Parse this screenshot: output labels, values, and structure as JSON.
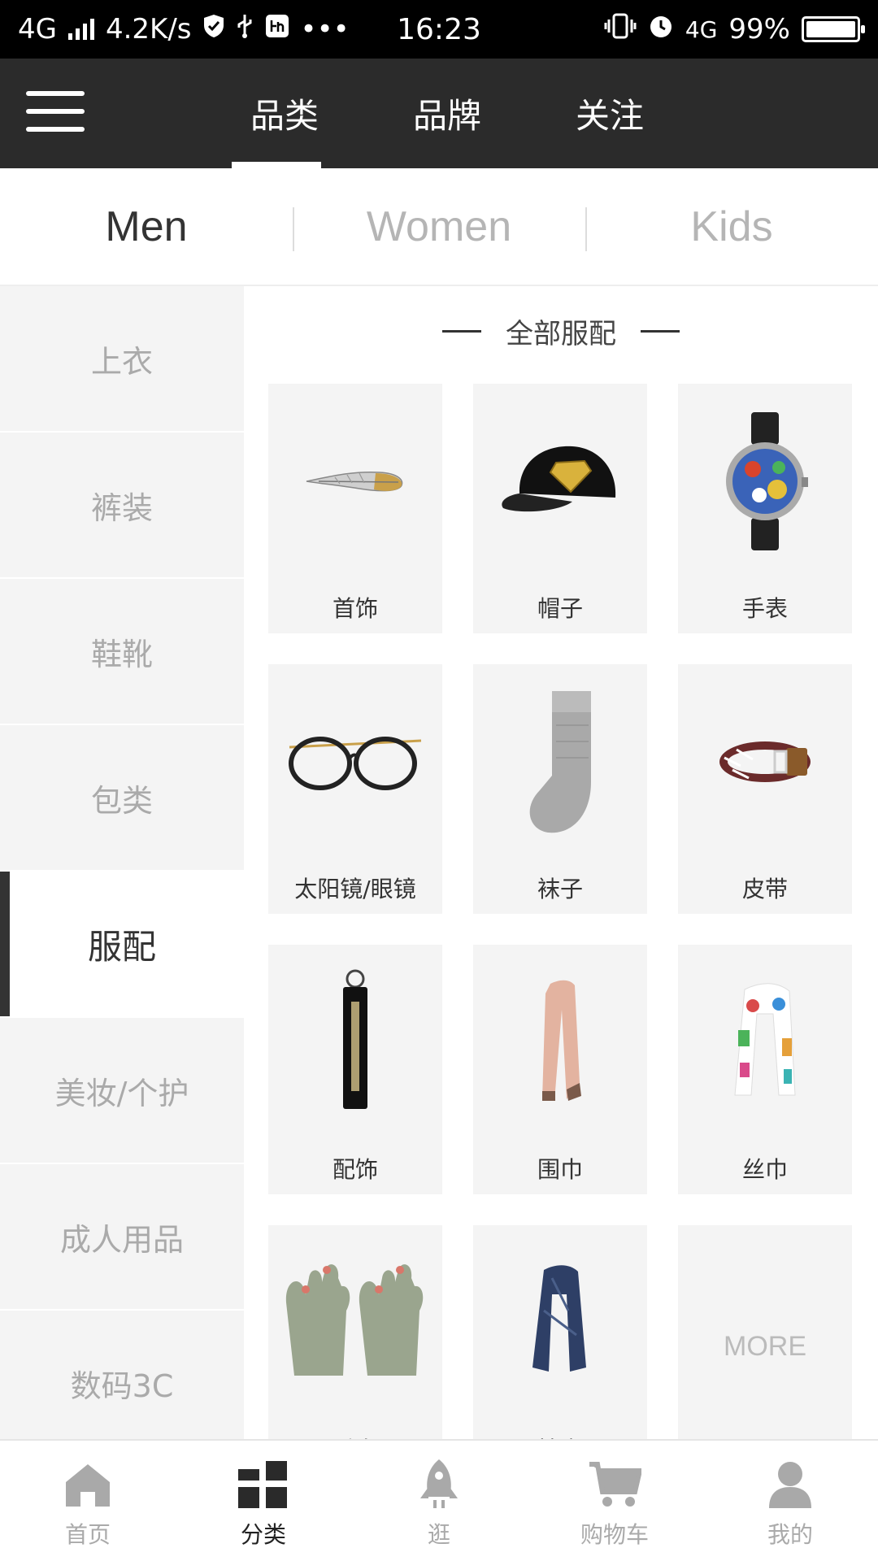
{
  "status_bar": {
    "network": "4G",
    "speed": "4.2K/s",
    "time": "16:23",
    "network2": "4G",
    "battery": "99%"
  },
  "top_nav": {
    "tabs": [
      {
        "label": "品类",
        "active": true
      },
      {
        "label": "品牌",
        "active": false
      },
      {
        "label": "关注",
        "active": false
      }
    ]
  },
  "gender_tabs": [
    {
      "label": "Men",
      "active": true
    },
    {
      "label": "Women",
      "active": false
    },
    {
      "label": "Kids",
      "active": false
    }
  ],
  "sidebar": {
    "items": [
      {
        "label": "上衣",
        "active": false
      },
      {
        "label": "裤装",
        "active": false
      },
      {
        "label": "鞋靴",
        "active": false
      },
      {
        "label": "包类",
        "active": false
      },
      {
        "label": "服配",
        "active": true
      },
      {
        "label": "美妆/个护",
        "active": false
      },
      {
        "label": "成人用品",
        "active": false
      },
      {
        "label": "数码3C",
        "active": false
      }
    ]
  },
  "content": {
    "section_title": "全部服配",
    "items": [
      {
        "label": "首饰",
        "icon": "feather-jewelry-icon"
      },
      {
        "label": "帽子",
        "icon": "cap-icon"
      },
      {
        "label": "手表",
        "icon": "watch-icon"
      },
      {
        "label": "太阳镜/眼镜",
        "icon": "glasses-icon"
      },
      {
        "label": "袜子",
        "icon": "sock-icon"
      },
      {
        "label": "皮带",
        "icon": "belt-icon"
      },
      {
        "label": "配饰",
        "icon": "keychain-icon"
      },
      {
        "label": "围巾",
        "icon": "scarf-icon"
      },
      {
        "label": "丝巾",
        "icon": "silk-scarf-icon"
      },
      {
        "label": "手套",
        "icon": "gloves-icon"
      },
      {
        "label": "披肩",
        "icon": "shawl-icon"
      },
      {
        "label": "MORE",
        "icon": ""
      }
    ]
  },
  "bottom_nav": {
    "items": [
      {
        "label": "首页",
        "icon": "home-icon",
        "active": false
      },
      {
        "label": "分类",
        "icon": "category-icon",
        "active": true
      },
      {
        "label": "逛",
        "icon": "rocket-icon",
        "active": false
      },
      {
        "label": "购物车",
        "icon": "cart-icon",
        "active": false
      },
      {
        "label": "我的",
        "icon": "user-icon",
        "active": false
      }
    ]
  }
}
